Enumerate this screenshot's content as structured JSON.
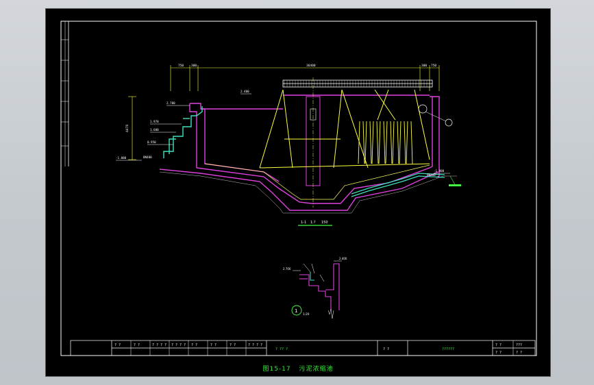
{
  "drawing": {
    "section_label": "1-1",
    "section_scale": "1:? ",
    "section_scale_extra": "150",
    "detail_number": "1",
    "detail_scale": "1:20",
    "dims": {
      "top_left_a": "750",
      "top_left_b": "300",
      "top_mid": "36400",
      "top_right_a": "300",
      "top_right_b": "750",
      "height": "4470",
      "lev_top_left": "2.700",
      "lev_water": "2.400",
      "lev_pipe_1": "1.970",
      "lev_pipe_2": "1.600",
      "lev_pipe_3": "0.950",
      "lev_bottom_left": "-1.000",
      "lev_right": "-1.800",
      "pipe_left": "DN400",
      "pipe_right": "DN300",
      "detail_lev_a": "2.700",
      "detail_lev_b": "2.400"
    },
    "title_block": {
      "cells": [
        "? ?",
        "? ?",
        "? ? ? ?",
        "? ? ? ?",
        "? ?",
        "? ?",
        "? ?",
        "? ? ? ?"
      ],
      "project": "? ?? ?",
      "drawing_name": "? ?",
      "code": "??????",
      "sheet": "? ?",
      "sheet_no": "???",
      "sheet2": "? ?",
      "sheet2_no": "? ?"
    },
    "caption_code": "图15-17",
    "caption_title": "污泥浓缩池"
  },
  "colors": {
    "frame": "#ffffff",
    "wall": "#e040e0",
    "equipment": "#ffff40",
    "pipe": "#40e0c0",
    "dimension": "#ffff40",
    "text": "#ffffff",
    "label_green": "#40ff40"
  }
}
